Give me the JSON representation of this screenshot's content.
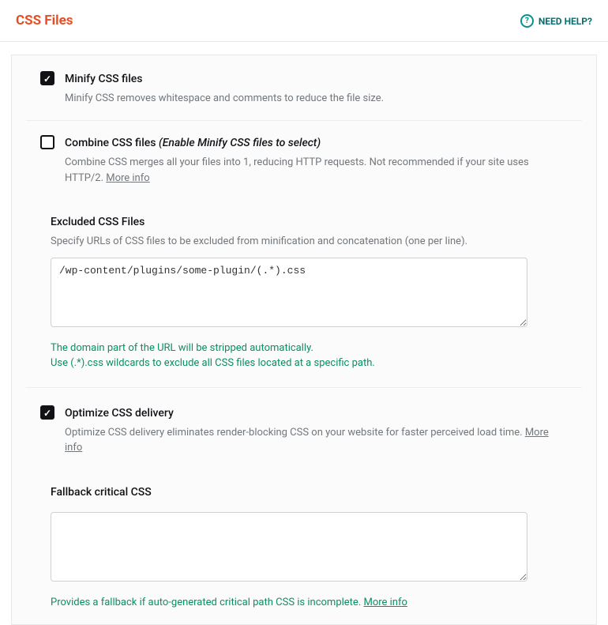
{
  "header": {
    "title": "CSS Files",
    "help": "NEED HELP?"
  },
  "options": {
    "minify": {
      "label": "Minify CSS files",
      "desc": "Minify CSS removes whitespace and comments to reduce the file size."
    },
    "combine": {
      "label": "Combine CSS files ",
      "hint": "(Enable Minify CSS files to select)",
      "desc": "Combine CSS merges all your files into 1, reducing HTTP requests. Not recommended if your site uses HTTP/2. ",
      "more": "More info"
    },
    "excluded": {
      "title": "Excluded CSS Files",
      "desc": "Specify URLs of CSS files to be excluded from minification and concatenation (one per line).",
      "value": "/wp-content/plugins/some-plugin/(.*).css",
      "help1": "The domain part of the URL will be stripped automatically.",
      "help2": "Use (.*).css wildcards to exclude all CSS files located at a specific path."
    },
    "optimize": {
      "label": "Optimize CSS delivery",
      "desc": "Optimize CSS delivery eliminates render-blocking CSS on your website for faster perceived load time. ",
      "more": "More info"
    },
    "fallback": {
      "title": "Fallback critical CSS",
      "value": "",
      "help": "Provides a fallback if auto-generated critical path CSS is incomplete. ",
      "more": "More info"
    }
  }
}
